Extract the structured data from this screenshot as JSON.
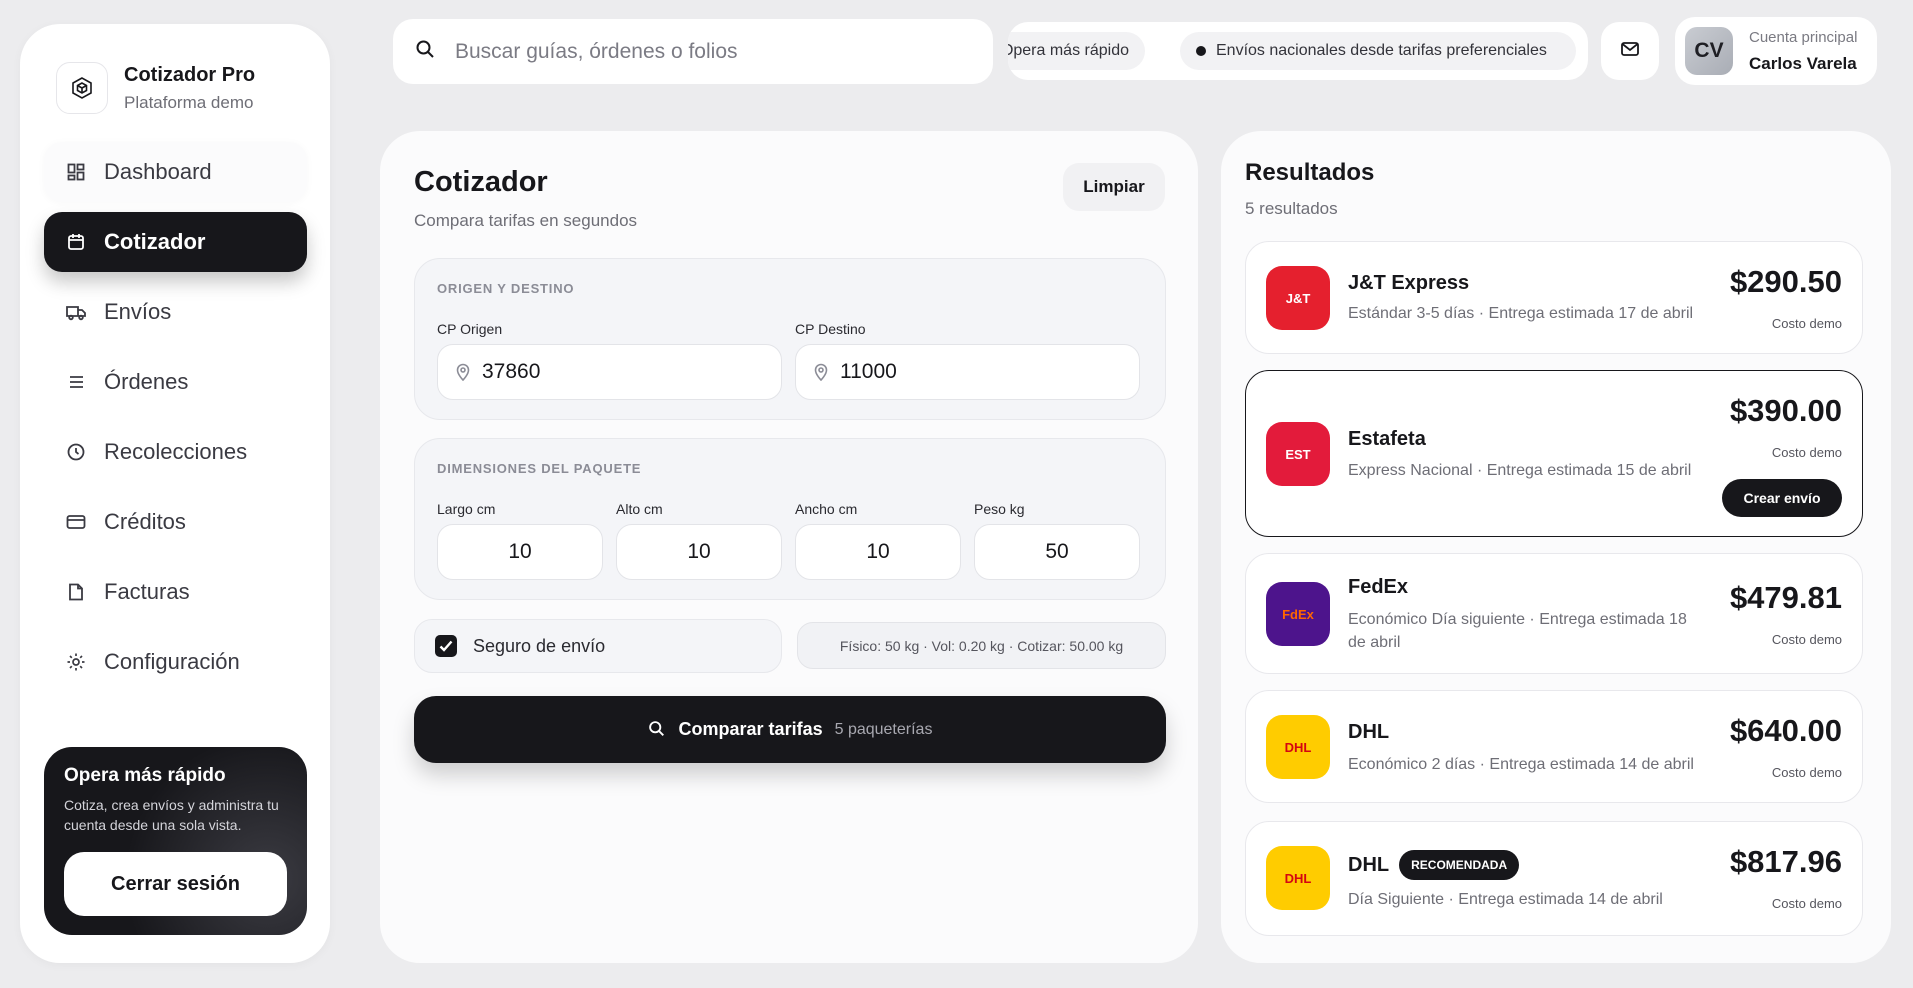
{
  "brand": {
    "name": "Cotizador Pro",
    "subtitle": "Plataforma demo",
    "icon": "cube-icon"
  },
  "sidebar": {
    "items": [
      {
        "label": "Dashboard",
        "icon": "grid-icon"
      },
      {
        "label": "Cotizador",
        "icon": "calendar-icon",
        "active": true
      },
      {
        "label": "Envíos",
        "icon": "truck-icon"
      },
      {
        "label": "Órdenes",
        "icon": "list-icon"
      },
      {
        "label": "Recolecciones",
        "icon": "clock-icon"
      },
      {
        "label": "Créditos",
        "icon": "card-icon"
      },
      {
        "label": "Facturas",
        "icon": "document-icon"
      },
      {
        "label": "Configuración",
        "icon": "gear-icon"
      }
    ],
    "promo": {
      "title": "Opera más rápido",
      "text": "Cotiza, crea envíos y administra tu cuenta desde una sola vista.",
      "logout_label": "Cerrar sesión"
    }
  },
  "topbar": {
    "search_placeholder": "Buscar guías, órdenes o folios",
    "ticker": [
      "Opera más rápido",
      "Envíos nacionales desde tarifas preferenciales"
    ],
    "account": {
      "initials": "CV",
      "label": "Cuenta principal",
      "name": "Carlos Varela"
    }
  },
  "quote": {
    "title": "Cotizador",
    "subtitle": "Compara tarifas en segundos",
    "clear_label": "Limpiar",
    "origin_destination": {
      "title": "ORIGEN Y DESTINO",
      "origin_label": "CP Origen",
      "origin_value": "37860",
      "destination_label": "CP Destino",
      "destination_value": "11000"
    },
    "dimensions": {
      "title": "DIMENSIONES DEL PAQUETE",
      "fields": [
        {
          "label": "Largo cm",
          "value": "10"
        },
        {
          "label": "Alto cm",
          "value": "10"
        },
        {
          "label": "Ancho cm",
          "value": "10"
        },
        {
          "label": "Peso kg",
          "value": "50"
        }
      ]
    },
    "insurance_label": "Seguro de envío",
    "insurance_checked": true,
    "weight_summary": "Físico: 50 kg · Vol: 0.20 kg · Cotizar: 50.00 kg",
    "compare_label": "Comparar tarifas",
    "compare_count": "5 paqueterías"
  },
  "results": {
    "title": "Resultados",
    "count": "5 resultados",
    "items": [
      {
        "code": "J&T",
        "name": "J&T Express",
        "desc": "Estándar 3-5 días · Entrega estimada 17 de abril",
        "price": "$290.50",
        "note": "Costo demo",
        "logo_bg": "#e5202e",
        "logo_fg": "#ffffff"
      },
      {
        "code": "EST",
        "name": "Estafeta",
        "desc": "Express Nacional · Entrega estimada 15 de abril",
        "price": "$390.00",
        "note": "Costo demo",
        "logo_bg": "#e31b3b",
        "logo_fg": "#ffffff",
        "action": "Crear envío"
      },
      {
        "code": "FdEx",
        "name": "FedEx",
        "desc": "Económico Día siguiente · Entrega estimada 18 de abril",
        "price": "$479.81",
        "note": "Costo demo",
        "logo_bg": "#4d148c",
        "logo_fg": "#ff6600"
      },
      {
        "code": "DHL",
        "name": "DHL",
        "desc": "Económico 2 días · Entrega estimada 14 de abril",
        "price": "$640.00",
        "note": "Costo demo",
        "logo_bg": "#ffcc00",
        "logo_fg": "#d40511"
      },
      {
        "code": "DHL",
        "name": "DHL",
        "badge": "RECOMENDADA",
        "desc": "Día Siguiente · Entrega estimada 14 de abril",
        "price": "$817.96",
        "note": "Costo demo",
        "logo_bg": "#ffcc00",
        "logo_fg": "#d40511"
      }
    ]
  }
}
